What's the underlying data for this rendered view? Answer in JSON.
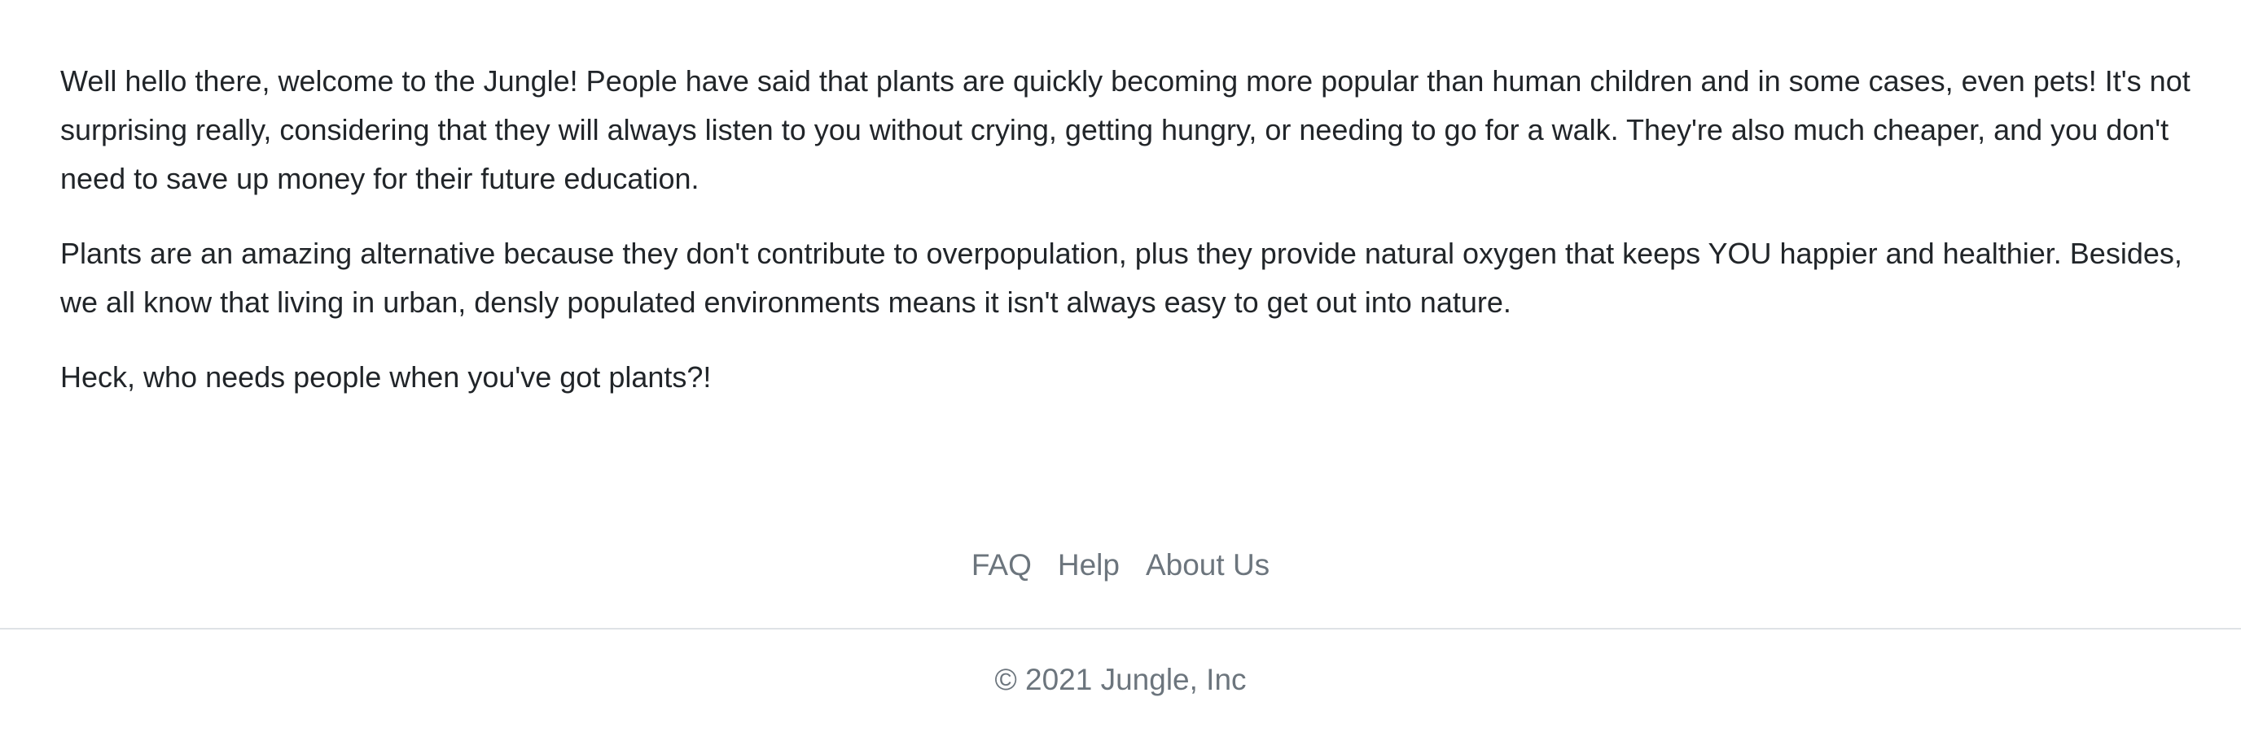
{
  "main": {
    "paragraphs": [
      "Well hello there, welcome to the Jungle! People have said that plants are quickly becoming more popular than human children and in some cases, even pets! It's not surprising really, considering that they will always listen to you without crying, getting hungry, or needing to go for a walk. They're also much cheaper, and you don't need to save up money for their future education.",
      "Plants are an amazing alternative because they don't contribute to overpopulation, plus they provide natural oxygen that keeps YOU happier and healthier. Besides, we all know that living in urban, densly populated environments means it isn't always easy to get out into nature.",
      "Heck, who needs people when you've got plants?!"
    ]
  },
  "footer": {
    "links": [
      {
        "label": "FAQ"
      },
      {
        "label": "Help"
      },
      {
        "label": "About Us"
      }
    ],
    "copyright": "© 2021 Jungle, Inc"
  },
  "colors": {
    "text": "#212529",
    "muted": "#6c757d",
    "divider": "#dee2e6",
    "background": "#ffffff"
  }
}
